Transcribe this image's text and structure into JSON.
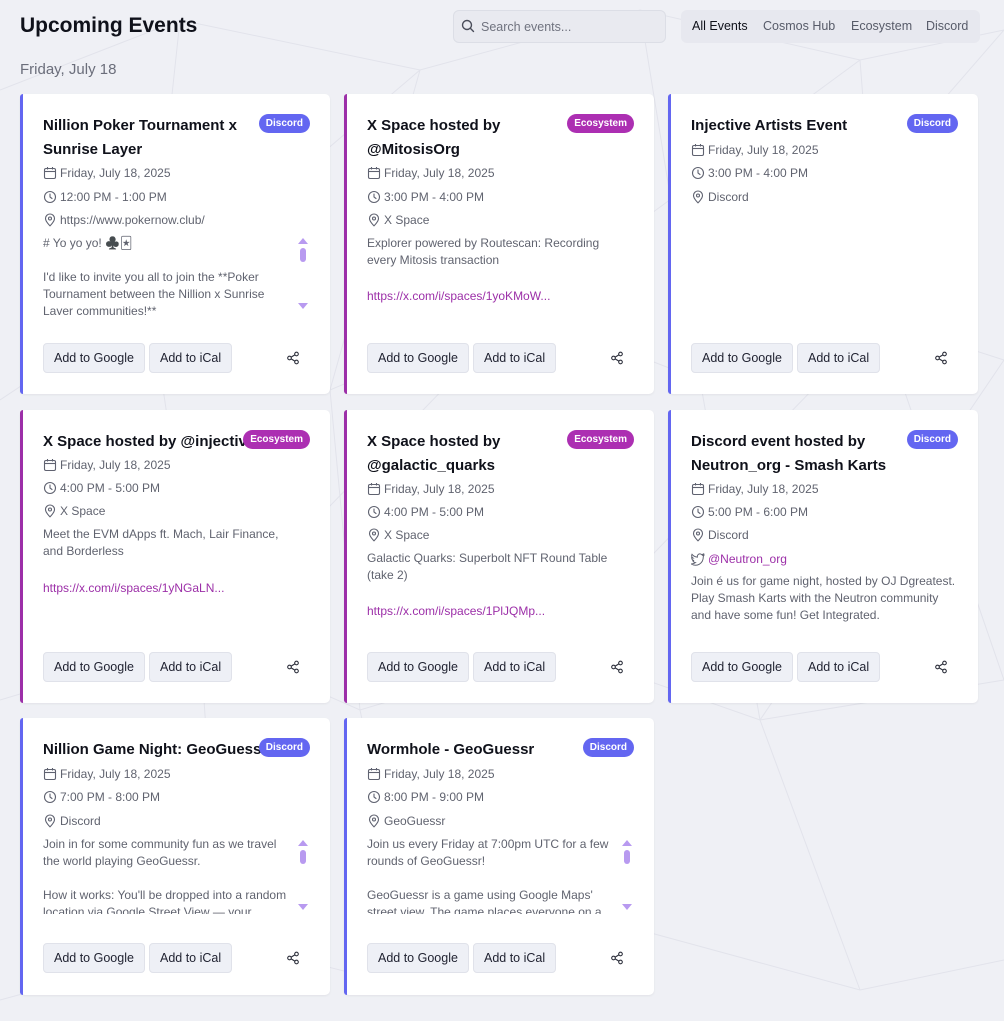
{
  "header": {
    "title": "Upcoming Events",
    "search_placeholder": "Search events...",
    "tabs": [
      "All Events",
      "Cosmos Hub",
      "Ecosystem",
      "Discord"
    ]
  },
  "date_heading": "Friday, July 18",
  "buttons": {
    "google": "Add to Google",
    "ical": "Add to iCal"
  },
  "colors": {
    "discord": "#6366f1",
    "ecosystem": "#9c2fa8"
  },
  "events": [
    {
      "title": "Nillion Poker Tournament x Sunrise Layer",
      "badge": "Discord",
      "date": "Friday, July 18, 2025",
      "time": "12:00 PM - 1:00 PM",
      "location": "https://www.pokernow.club/",
      "desc": [
        "# Yo yo yo! ♣️🃏",
        "I'd like to invite you all to join the **Poker Tournament between the Nillion x Sunrise Layer communities!**"
      ]
    },
    {
      "title": "X Space hosted by @MitosisOrg",
      "badge": "Ecosystem",
      "date": "Friday, July 18, 2025",
      "time": "3:00 PM - 4:00 PM",
      "location": "X Space",
      "desc": [
        "Explorer powered by Routescan: Recording every Mitosis transaction"
      ],
      "link": "https://x.com/i/spaces/1yoKMoW..."
    },
    {
      "title": "Injective Artists Event",
      "badge": "Discord",
      "date": "Friday, July 18, 2025",
      "time": "3:00 PM - 4:00 PM",
      "location": "Discord"
    },
    {
      "title": "X Space hosted by @injective",
      "badge": "Ecosystem",
      "date": "Friday, July 18, 2025",
      "time": "4:00 PM - 5:00 PM",
      "location": "X Space",
      "desc": [
        "Meet the EVM dApps ft. Mach, Lair Finance, and Borderless"
      ],
      "link": "https://x.com/i/spaces/1yNGaLN..."
    },
    {
      "title": "X Space hosted by @galactic_quarks",
      "badge": "Ecosystem",
      "date": "Friday, July 18, 2025",
      "time": "4:00 PM - 5:00 PM",
      "location": "X Space",
      "desc": [
        "Galactic Quarks: Superbolt NFT Round Table (take 2)"
      ],
      "link": "https://x.com/i/spaces/1PlJQMp..."
    },
    {
      "title": "Discord event hosted by Neutron_org - Smash Karts",
      "badge": "Discord",
      "date": "Friday, July 18, 2025",
      "time": "5:00 PM - 6:00 PM",
      "location": "Discord",
      "twitter": "@Neutron_org",
      "desc": [
        "Join é us for game night, hosted by OJ Dgreatest. Play Smash Karts with the Neutron community and have some fun! Get Integrated."
      ]
    },
    {
      "title": "Nillion Game Night: GeoGuessr",
      "badge": "Discord",
      "date": "Friday, July 18, 2025",
      "time": "7:00 PM - 8:00 PM",
      "location": "Discord",
      "desc": [
        "Join in for some community fun as we travel the world playing GeoGuessr.",
        "How it works: You'll be dropped into a random location via Google Street View — your mission is to guess where you are."
      ]
    },
    {
      "title": "Wormhole - GeoGuessr",
      "badge": "Discord",
      "date": "Friday, July 18, 2025",
      "time": "8:00 PM - 9:00 PM",
      "location": "GeoGuessr",
      "desc": [
        "Join us every Friday at 7:00pm UTC for a few rounds of GeoGuessr!",
        "GeoGuessr is a game using Google Maps' street view. The game places everyone on a random location."
      ]
    }
  ]
}
